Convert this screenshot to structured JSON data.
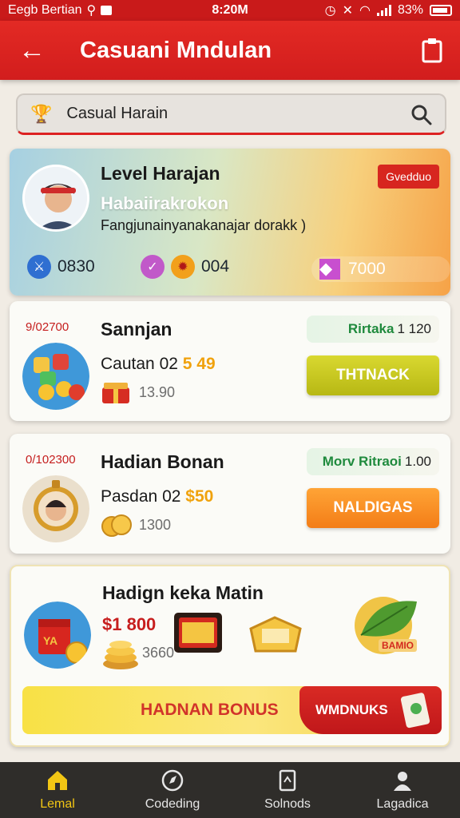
{
  "status_bar": {
    "left_text": "Eegb Bertian",
    "time": "8:20M",
    "battery": "83%"
  },
  "app_bar": {
    "title": "Casuani Mndulan"
  },
  "search": {
    "value": "Casual Harain"
  },
  "profile": {
    "name": "Level Harajan",
    "badge": "Gvedduo",
    "subtitle": "Habaiirakrokon",
    "description": "Fangjunainyanakanajar dorakk )",
    "stats": [
      {
        "value": "0830",
        "color": "#2f6fd1"
      },
      {
        "value": "004",
        "color": "#c159c9"
      },
      {
        "value": "7000",
        "color": "#c84fcf"
      }
    ]
  },
  "rewards": [
    {
      "code": "9/02700",
      "title": "Sannjan",
      "price_label": "Cautan",
      "price_num": "02",
      "price_highlight": "5 49",
      "coins": "13.90",
      "chip_label": "Rirtaka",
      "chip_value": "1 120",
      "button": "THTNACK"
    },
    {
      "code": "0/102300",
      "title": "Hadian Bonan",
      "price_label": "Pasdan",
      "price_num": "02",
      "price_highlight": "$50",
      "coins": "1300",
      "chip_label": "Morv Ritraoi",
      "chip_value": "1.00",
      "button": "NALDIGAS"
    }
  ],
  "bonus": {
    "title": "Hadign keka Matin",
    "price": "$1 800",
    "coins": "3660",
    "bar_label": "HADNAN BONUS",
    "bar_button": "WMDNUKS",
    "leaf_badge": "BAMIO"
  },
  "bottom_nav": [
    {
      "label": "Lemal",
      "icon": "home-icon",
      "active": true
    },
    {
      "label": "Codeding",
      "icon": "compass-icon",
      "active": false
    },
    {
      "label": "Solnods",
      "icon": "document-icon",
      "active": false
    },
    {
      "label": "Lagadica",
      "icon": "user-icon",
      "active": false
    }
  ],
  "colors": {
    "primary_red": "#d21d1d",
    "accent_yellow": "#f2c614",
    "accent_orange": "#f37d17"
  }
}
